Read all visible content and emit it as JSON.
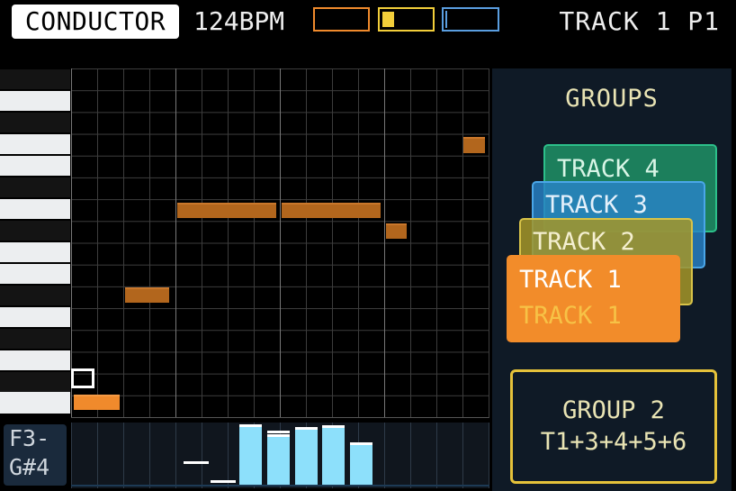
{
  "header": {
    "app_title": "CONDUCTOR",
    "bpm": "124BPM",
    "track_indicator": "TRACK 1 P1",
    "pattern_colors": [
      "#f08a2c",
      "#f2ce3a",
      "#5a9ee0"
    ],
    "pattern_progress": [
      0.0,
      0.22,
      0.04
    ]
  },
  "sequencer": {
    "range_label_line1": "F3-",
    "range_label_line2": "G#4",
    "note_color": "#b2661d",
    "active_note_color": "#f08a2c",
    "velocity_color": "#8de0fb"
  },
  "groups": {
    "title": "GROUPS",
    "cards": [
      {
        "label": "TRACK 4",
        "color": "#2cc08a"
      },
      {
        "label": "TRACK 3",
        "ghost": "TRACK 4",
        "color": "#4aa6e8"
      },
      {
        "label": "TRACK 2",
        "ghost": "TRACK 3",
        "color": "#d8c348"
      },
      {
        "label": "TRACK 1",
        "sub": "TRACK 1",
        "color": "#f28c2a"
      }
    ],
    "selected_group": {
      "name": "GROUP 2",
      "members": "T1+3+4+5+6"
    }
  }
}
